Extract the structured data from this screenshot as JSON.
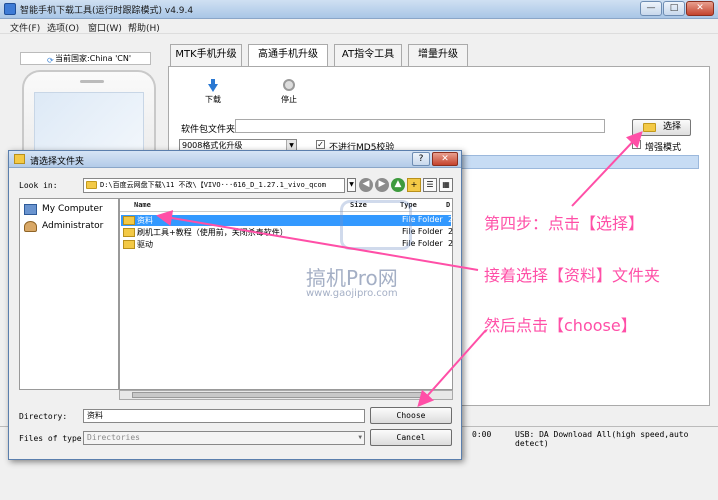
{
  "app": {
    "title": "智能手机下载工具(运行时跟踪模式)  v4.9.4",
    "window_buttons": [
      "—",
      "□",
      "✕"
    ],
    "menu": [
      "文件(F)",
      "选项(O)",
      "窗口(W)",
      "帮助(H)"
    ]
  },
  "left": {
    "country": "当前国家:China 'CN'"
  },
  "tabs": [
    "MTK手机升级",
    "高通手机升级",
    "AT指令工具",
    "增量升级"
  ],
  "toolbar": {
    "download": "下载",
    "stop": "停止"
  },
  "form": {
    "package_label": "软件包文件夹",
    "select_button": "选择",
    "format_value": "9008格式化升级",
    "no_md5_label": "不进行MD5校验",
    "no_md5_checked": "✓",
    "enhanced_label": "增强模式"
  },
  "status": {
    "time": "0:00",
    "usb": "USB: DA Download All(high speed,auto detect)"
  },
  "dialog": {
    "title": "请选择文件夹",
    "buttons": [
      "?",
      "✕"
    ],
    "lookin_label": "Look in:",
    "lookin_path": "D:\\百度云网盘下载\\11 不改\\【VIVO···616_D_1.27.1_vivo_qcom",
    "places": [
      "My Computer",
      "Administrator"
    ],
    "columns": [
      "Name",
      "Size",
      "Type",
      "D"
    ],
    "files": [
      {
        "name": "资料",
        "type": "File Folder",
        "mark": "2"
      },
      {
        "name": "刷机工具+教程（使用前，关闭杀毒软件）",
        "type": "File Folder",
        "mark": "2"
      },
      {
        "name": "驱动",
        "type": "File Folder",
        "mark": "2"
      }
    ],
    "directory_label": "Directory:",
    "directory_value": "资料",
    "filetype_label": "Files of type:",
    "filetype_value": "Directories",
    "choose_button": "Choose",
    "cancel_button": "Cancel"
  },
  "annotations": {
    "step4": "第四步：点击【选择】",
    "step_next": "接着选择【资料】文件夹",
    "step_final": "然后点击【choose】",
    "color": "#ff4fa7"
  },
  "watermark": {
    "brand": "搞机Pro网",
    "url": "www.gaojipro.com"
  }
}
